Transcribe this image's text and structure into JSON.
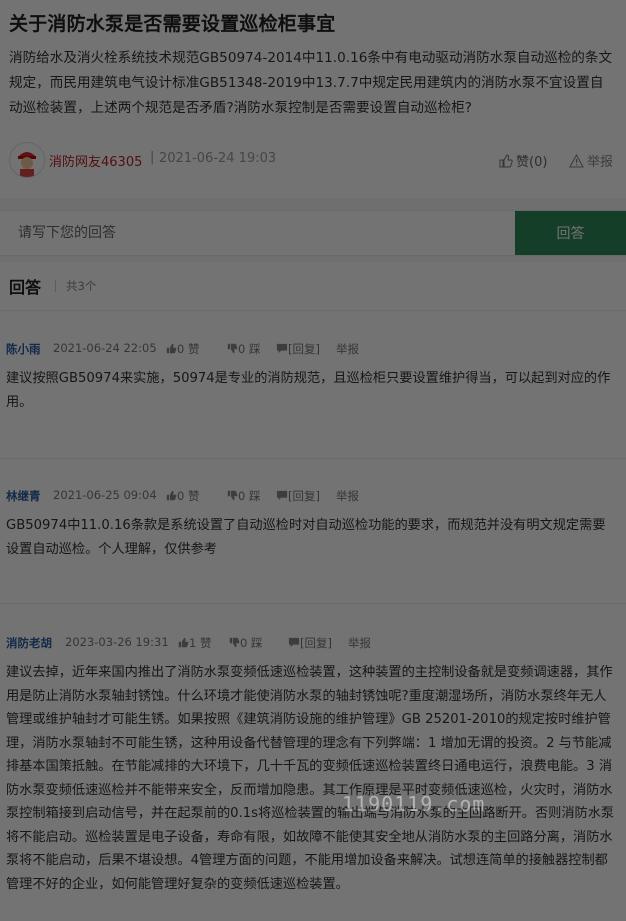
{
  "question": {
    "title": "关于消防水泵是否需要设置巡检柜事宜",
    "body": "消防给水及消火栓系统技术规范GB50974-2014中11.0.16条中有电动驱动消防水泵自动巡检的条文规定，而民用建筑电气设计标准GB51348-2019中13.7.7中规定民用建筑内的消防水泵不宜设置自动巡检装置，上述两个规范是否矛盾?消防水泵控制是否需要设置自动巡检柜?",
    "author": "消防网友46305",
    "separator": "|",
    "date": "2021-06-24 19:03",
    "like_label": "赞(0)",
    "report_label": "举报"
  },
  "answer_form": {
    "placeholder": "请写下您的回答",
    "submit_label": "回答"
  },
  "answers_header": {
    "title": "回答",
    "count": "共3个"
  },
  "answers": [
    {
      "user": "陈小雨",
      "date": "2021-06-24 22:05",
      "likes": "0 赞",
      "dislikes": "0 踩",
      "reply": "[回复]",
      "report": "举报",
      "text": "建议按照GB50974来实施，50974是专业的消防规范，且巡检柜只要设置维护得当，可以起到对应的作用。"
    },
    {
      "user": "林继青",
      "date": "2021-06-25 09:04",
      "likes": "0 赞",
      "dislikes": "0 踩",
      "reply": "[回复]",
      "report": "举报",
      "text": "GB50974中11.0.16条款是系统设置了自动巡检时对自动巡检功能的要求，而规范并没有明文规定需要设置自动巡检。个人理解，仅供参考"
    },
    {
      "user": "消防老胡",
      "date": "2023-03-26 19:31",
      "likes": "1 赞",
      "dislikes": "0 踩",
      "reply": "[回复]",
      "report": "举报",
      "text": "建议去掉，近年来国内推出了消防水泵变频低速巡检装置，这种装置的主控制设备就是变频调速器，其作用是防止消防水泵轴封锈蚀。什么环境才能使消防水泵的轴封锈蚀呢?重度潮湿场所，消防水泵终年无人管理或维护轴封才可能生锈。如果按照《建筑消防设施的维护管理》GB 25201-2010的规定按时维护管理，消防水泵轴封不可能生锈，这种用设备代替管理的理念有下列弊端：1 增加无谓的投资。2 与节能减排基本国策抵触。在节能减排的大环境下，几十千瓦的变频低速巡检装置终日通电运行，浪费电能。3 消防水泵变频低速巡检并不能带来安全，反而增加隐患。其工作原理是平时变频低速巡检，火灾时，消防水泵控制箱接到启动信号，并在起泵前的0.1s将巡检装置的输出端与消防水泵的主回路断开。否则消防水泵将不能启动。巡检装置是电子设备，寿命有限，如故障不能使其安全地从消防水泵的主回路分离，消防水泵将不能启动，后果不堪设想。4管理方面的问题，不能用增加设备来解决。试想连简单的接触器控制都管理不好的企业，如何能管理好复杂的变频低速巡检装置。"
    }
  ],
  "watermark": "1190119.com",
  "icons": {
    "avatar": "firefighter-avatar",
    "like": "thumbs-up-icon",
    "dislike": "thumbs-down-icon",
    "reply": "comment-icon",
    "report": "warning-icon"
  }
}
